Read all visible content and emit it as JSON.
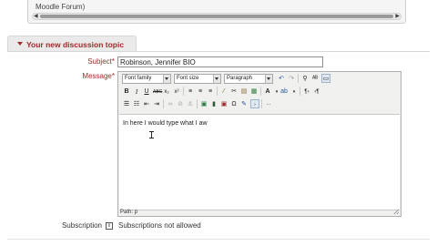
{
  "top_box": {
    "text": "Moodle Forum)"
  },
  "section": {
    "title": "Your new discussion topic"
  },
  "subject": {
    "label": "Subject",
    "required_mark": "*",
    "value": "Robinson, Jennifer BIO"
  },
  "message": {
    "label": "Message",
    "required_mark": "*",
    "toolbar": {
      "font_family": "Font family",
      "font_size": "Font size",
      "paragraph": "Paragraph"
    },
    "content": "In here I would type what I aw",
    "path": "Path: p"
  },
  "subscription": {
    "label": "Subscription",
    "help_icon": "help-icon",
    "value": "Subscriptions not allowed"
  }
}
